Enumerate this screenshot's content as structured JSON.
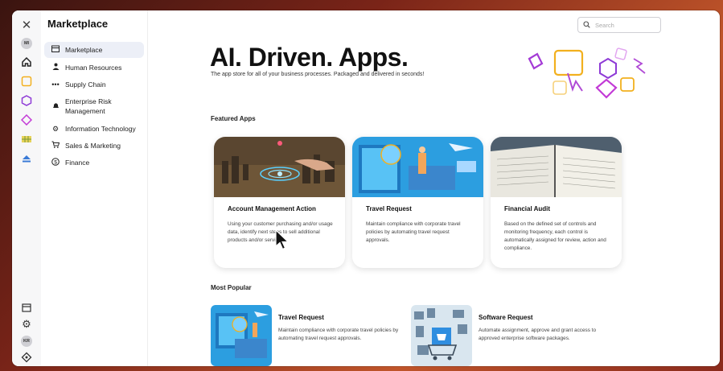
{
  "sidebar": {
    "title": "Marketplace",
    "items": [
      {
        "label": "Marketplace",
        "icon": "storefront-icon"
      },
      {
        "label": "Human Resources",
        "icon": "person-icon"
      },
      {
        "label": "Supply Chain",
        "icon": "dots-icon"
      },
      {
        "label": "Enterprise Risk Management",
        "icon": "alarm-icon"
      },
      {
        "label": "Information Technology",
        "icon": "gear-icon"
      },
      {
        "label": "Sales & Marketing",
        "icon": "cart-icon"
      },
      {
        "label": "Finance",
        "icon": "dollar-icon"
      }
    ]
  },
  "rail": {
    "top_avatar": "MI",
    "bottom_avatar": "KR"
  },
  "search": {
    "placeholder": "Search"
  },
  "hero": {
    "title": "AI. Driven. Apps.",
    "subtitle": "The app store for all of your business processes. Packaged and delivered in seconds!"
  },
  "featured": {
    "heading": "Featured Apps",
    "cards": [
      {
        "title": "Account Management Action",
        "description": "Using your customer purchasing and/or usage data, identify next steps to sell additional products and/or services."
      },
      {
        "title": "Travel Request",
        "description": "Maintain compliance with corporate travel policies by automating travel request approvals."
      },
      {
        "title": "Financial Audit",
        "description": "Based on the defined set of controls and monitoring frequency, each control is automatically assigned for review, action and compliance."
      }
    ]
  },
  "popular": {
    "heading": "Most Popular",
    "cards": [
      {
        "title": "Travel Request",
        "description": "Maintain compliance with corporate travel policies by automating travel request approvals."
      },
      {
        "title": "Software Request",
        "description": "Automate assignment, approve and grant access to approved enterprise software packages."
      }
    ]
  },
  "colors": {
    "accent_purple": "#a43bd6",
    "accent_orange": "#f2b01e",
    "active_nav": "#eceff7"
  }
}
